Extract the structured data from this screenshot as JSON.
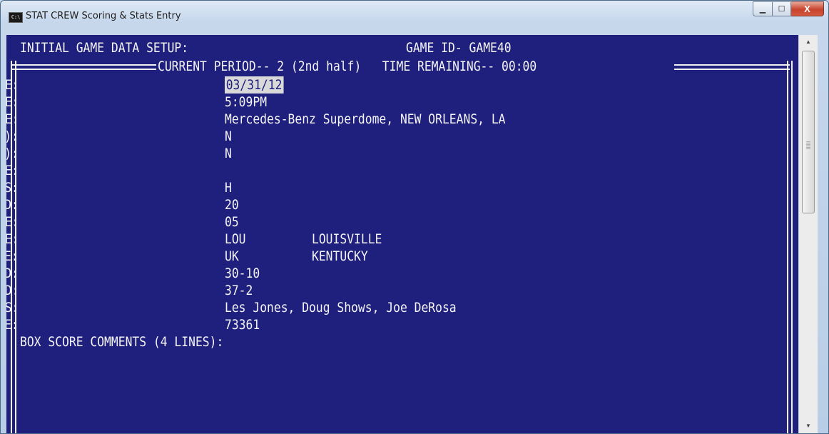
{
  "window": {
    "title": "STAT CREW Scoring & Stats Entry",
    "icon_label": "C:\\",
    "controls": {
      "minimize": "▁",
      "maximize": "☐",
      "close": "X"
    }
  },
  "screen": {
    "header_left": "INITIAL GAME DATA SETUP:",
    "header_right": "GAME ID- GAME40",
    "period_line": "CURRENT PERIOD-- 2 (2nd half)   TIME REMAINING-- 00:00"
  },
  "fields": [
    {
      "label": "GAME DATE:",
      "value": "03/31/12",
      "selected": true
    },
    {
      "label": "GAME TIME:",
      "value": "5:09PM"
    },
    {
      "label": "SITE OF THE GAME:",
      "value": "Mercedes-Benz Superdome, NEW ORLEANS, LA"
    },
    {
      "label": "SITE CODE (H/N/A):",
      "value": "N"
    },
    {
      "label": "LEAGUE GAME (Y/N):",
      "value": "N"
    },
    {
      "label": "SCHEDULE NOTE:",
      "value": ""
    },
    {
      "label": "QUARTERS/HALVES:",
      "value": "H"
    },
    {
      "label": "# MINS PER PERIOD:",
      "value": "20"
    },
    {
      "label": "# MINS IN OVERTIME:",
      "value": "05"
    },
    {
      "label": "VISITING TEAM CODE:",
      "value": "LOU",
      "team_name": "LOUISVILLE"
    },
    {
      "label": "HOME TEAM CODE:",
      "value": "UK",
      "team_name": "KENTUCKY"
    },
    {
      "label": "VISITORS RECORD:",
      "value": "30-10"
    },
    {
      "label": "HOME TEAM RECORD:",
      "value": "37-2"
    },
    {
      "label": "OFFICIALS:",
      "value": "Les Jones, Doug Shows, Joe DeRosa"
    },
    {
      "label": "ATTENDANCE:",
      "value": "73361"
    }
  ],
  "comments_label": "BOX SCORE COMMENTS (4 LINES):",
  "colors": {
    "console_bg": "#1f1f7e",
    "console_text": "#f4f4f4",
    "selection_bg": "#d9d9d9"
  }
}
